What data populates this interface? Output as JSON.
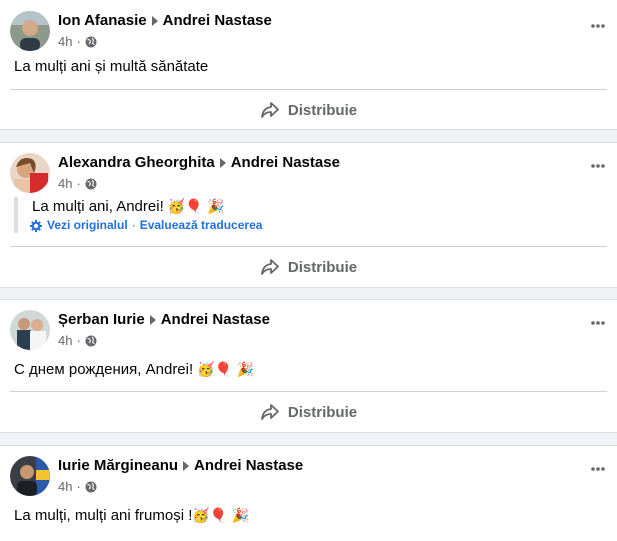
{
  "posts": [
    {
      "author": "Ion Afanasie",
      "target": "Andrei Nastase",
      "time": "4h",
      "text": "La mulți ani și multă sănătate",
      "share_label": "Distribuie"
    },
    {
      "author": "Alexandra Gheorghita",
      "target": "Andrei Nastase",
      "time": "4h",
      "text": "La mulți ani, Andrei!",
      "emojis": "🥳🎈 🎉",
      "see_original": "Vezi originalul",
      "separator": "·",
      "rate_translation": "Evaluează traducerea",
      "share_label": "Distribuie"
    },
    {
      "author": "Șerban Iurie",
      "target": "Andrei Nastase",
      "time": "4h",
      "text": "С днем рождения, Andrei!",
      "emojis": "🥳🎈 🎉",
      "share_label": "Distribuie"
    },
    {
      "author": "Iurie Mărgineanu",
      "target": "Andrei Nastase",
      "time": "4h",
      "text": "La mulți, mulți ani frumoși !",
      "emojis": "🥳🎈 🎉"
    }
  ],
  "meta_separator": "·",
  "icons": {
    "audience": "globe-icon",
    "options": "more-options-icon",
    "share": "share-icon",
    "direction": "arrow-right-icon"
  },
  "colors": {
    "link": "#216fdb",
    "secondary_text": "#65676b",
    "background": "#f0f2f5"
  }
}
